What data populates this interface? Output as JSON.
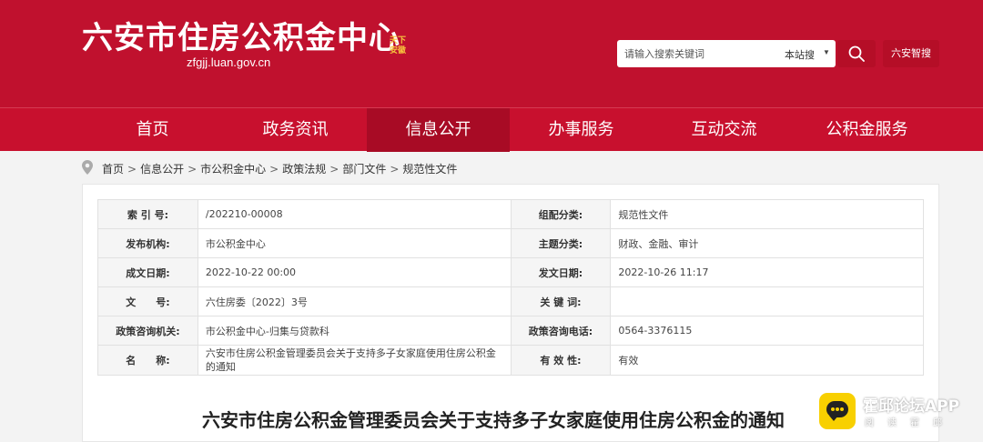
{
  "header": {
    "site_title": "六安市住房公积金中心",
    "site_url": "zfgjj.luan.gov.cn",
    "seal_text": [
      "天下",
      "安徽"
    ],
    "search": {
      "placeholder": "请输入搜索关键词",
      "scope": "本站搜",
      "smart_label": "六安智搜"
    },
    "colors": {
      "brand": "#c0112e",
      "nav_active": "#a80b25"
    }
  },
  "nav": {
    "items": [
      {
        "label": "首页"
      },
      {
        "label": "政务资讯"
      },
      {
        "label": "信息公开"
      },
      {
        "label": "办事服务"
      },
      {
        "label": "互动交流"
      },
      {
        "label": "公积金服务"
      }
    ],
    "active_index": 2
  },
  "breadcrumb": [
    "首页",
    "信息公开",
    "市公积金中心",
    "政策法规",
    "部门文件",
    "规范性文件"
  ],
  "meta_table": {
    "rows": [
      {
        "l1": "索 引 号:",
        "v1": "/202210-00008",
        "l2": "组配分类:",
        "v2": "规范性文件"
      },
      {
        "l1": "发布机构:",
        "v1": "市公积金中心",
        "l2": "主题分类:",
        "v2": "财政、金融、审计"
      },
      {
        "l1": "成文日期:",
        "v1": "2022-10-22 00:00",
        "l2": "发文日期:",
        "v2": "2022-10-26 11:17"
      },
      {
        "l1": "文　　号:",
        "v1": "六住房委〔2022〕3号",
        "l2": "关 键 词:",
        "v2": ""
      },
      {
        "l1": "政策咨询机关:",
        "v1": "市公积金中心-归集与贷款科",
        "l2": "政策咨询电话:",
        "v2": "0564-3376115"
      },
      {
        "l1": "名　　称:",
        "v1": "六安市住房公积金管理委员会关于支持多子女家庭使用住房公积金的通知",
        "l2": "有 效 性:",
        "v2": "有效"
      }
    ]
  },
  "document": {
    "title": "六安市住房公积金管理委员会关于支持多子女家庭使用住房公积金的通知"
  },
  "watermark": {
    "name": "霍邱论坛APP",
    "sub": "阅读霍邱"
  }
}
